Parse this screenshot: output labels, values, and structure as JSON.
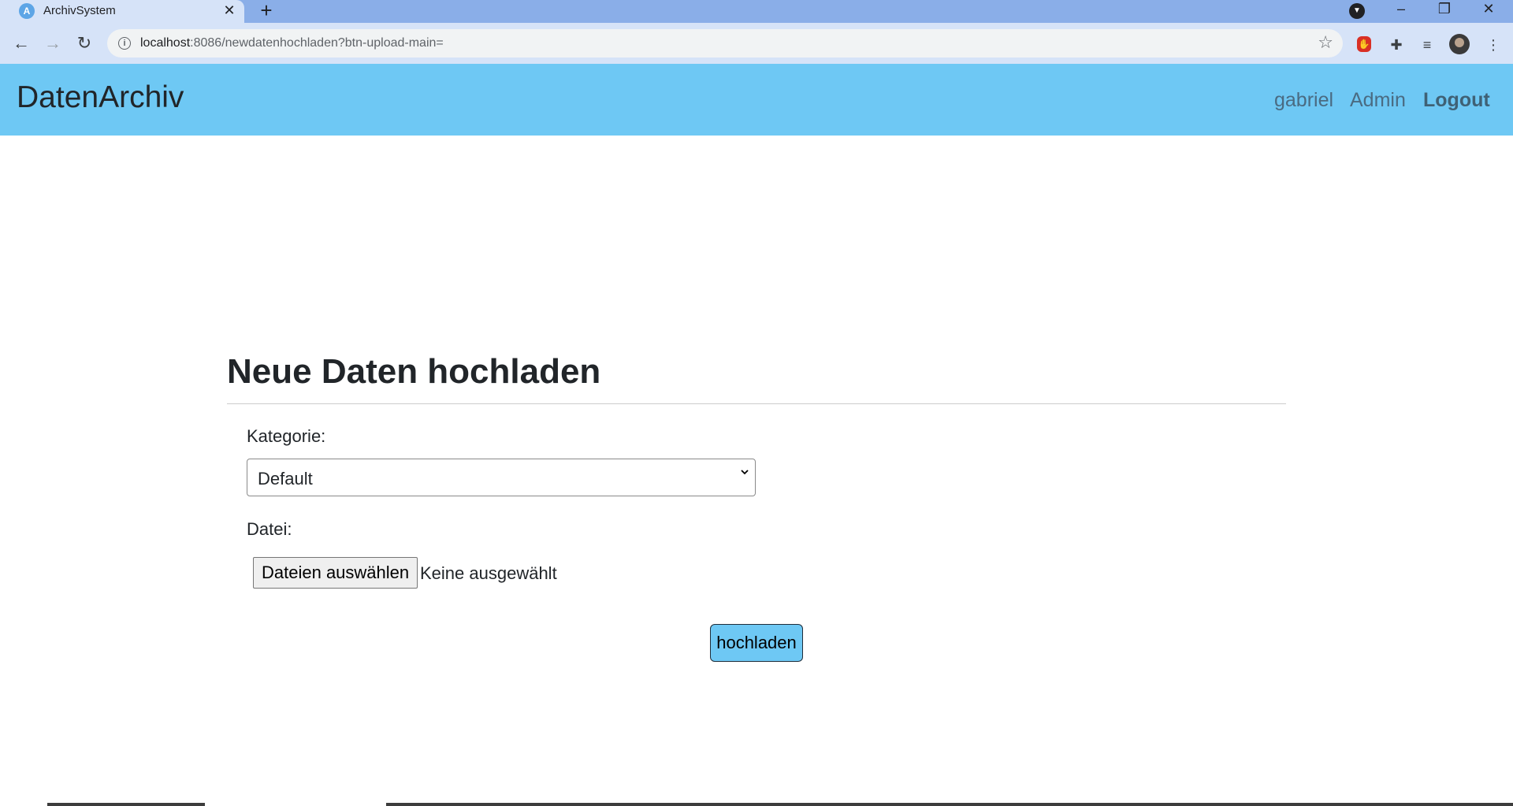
{
  "browser": {
    "tab_title": "ArchivSystem",
    "favicon_letter": "A",
    "url_host": "localhost",
    "url_rest": ":8086/newdatenhochladen?btn-upload-main="
  },
  "nav": {
    "brand": "DatenArchiv",
    "links": [
      "gabriel",
      "Admin",
      "Logout"
    ]
  },
  "main": {
    "title": "Neue Daten hochladen",
    "category_label": "Kategorie:",
    "category_selected": "Default",
    "file_label": "Datei:",
    "file_button": "Dateien auswählen",
    "file_status": "Keine ausgewählt",
    "submit_label": "hochladen"
  },
  "colors": {
    "navbar": "#6ec8f4",
    "tabbar": "#8aaee8",
    "submit": "#6ec8f4"
  }
}
